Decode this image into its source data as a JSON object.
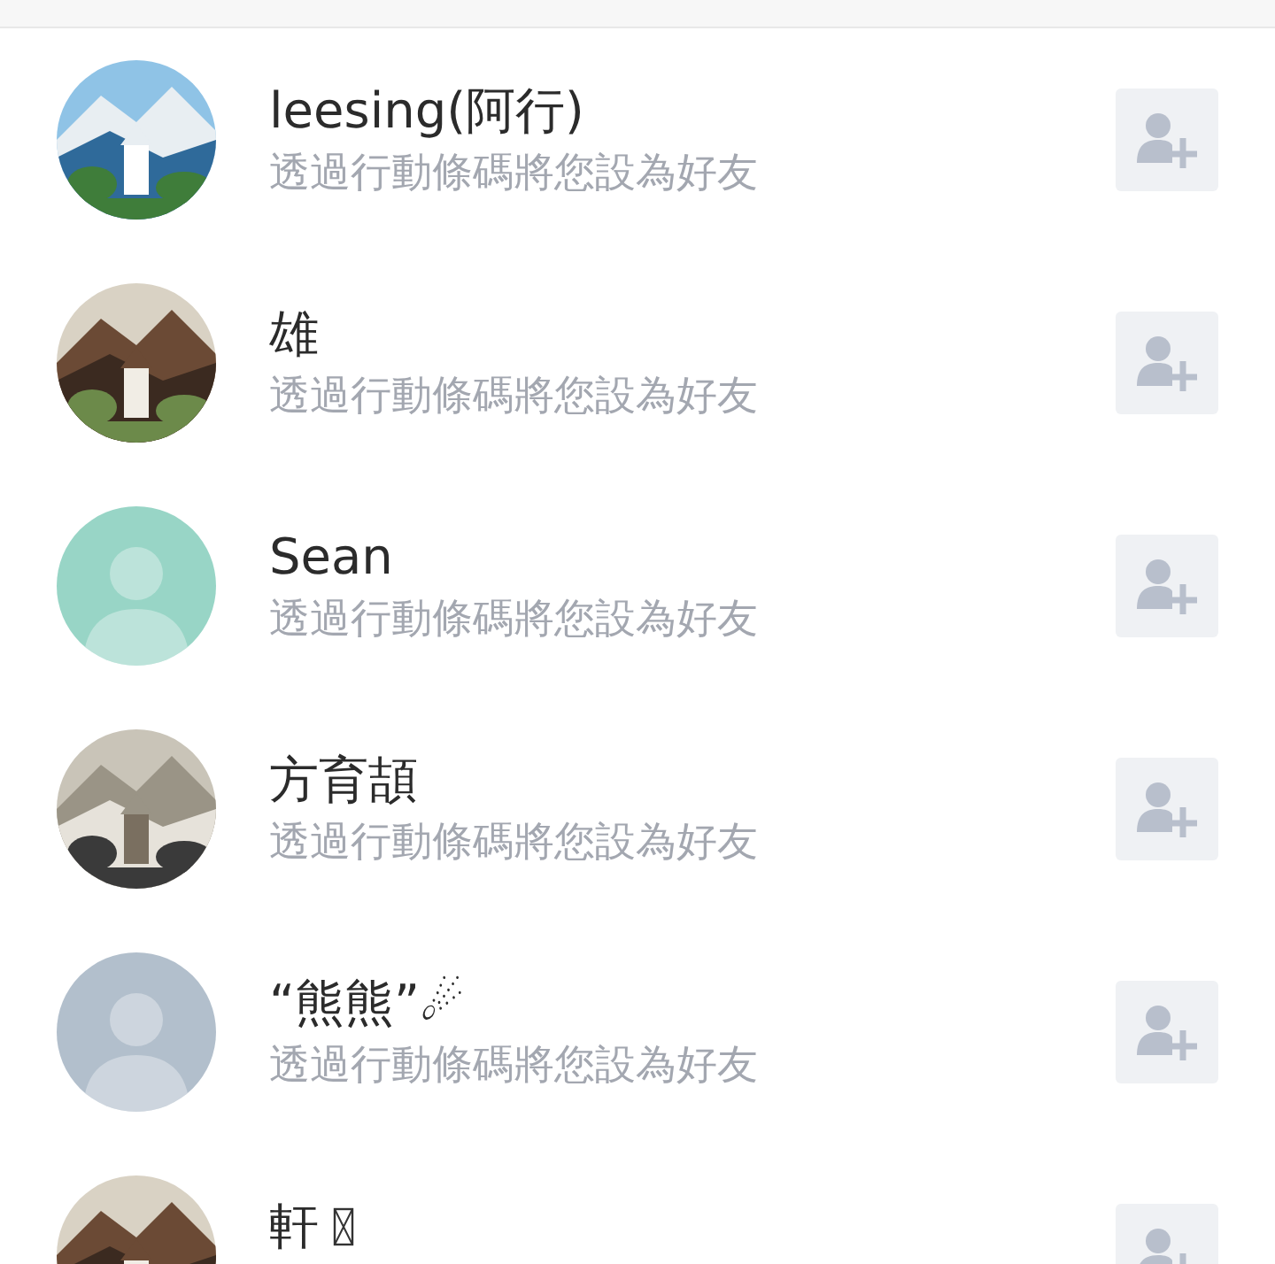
{
  "contacts": [
    {
      "name": "leesing(阿行)",
      "subtitle": "透過行動條碼將您設為好友"
    },
    {
      "name": "雄",
      "subtitle": "透過行動條碼將您設為好友"
    },
    {
      "name": "Sean",
      "subtitle": "透過行動條碼將您設為好友",
      "avatar": {
        "kind": "default",
        "color": "#98d5c6"
      }
    },
    {
      "name": "方育頡",
      "subtitle": "透過行動條碼將您設為好友"
    },
    {
      "name": "“熊熊”☄",
      "subtitle": "透過行動條碼將您設為好友",
      "avatar": {
        "kind": "default",
        "color": "#b2bfcc"
      }
    },
    {
      "name": "軒",
      "missing_glyph": true
    }
  ]
}
